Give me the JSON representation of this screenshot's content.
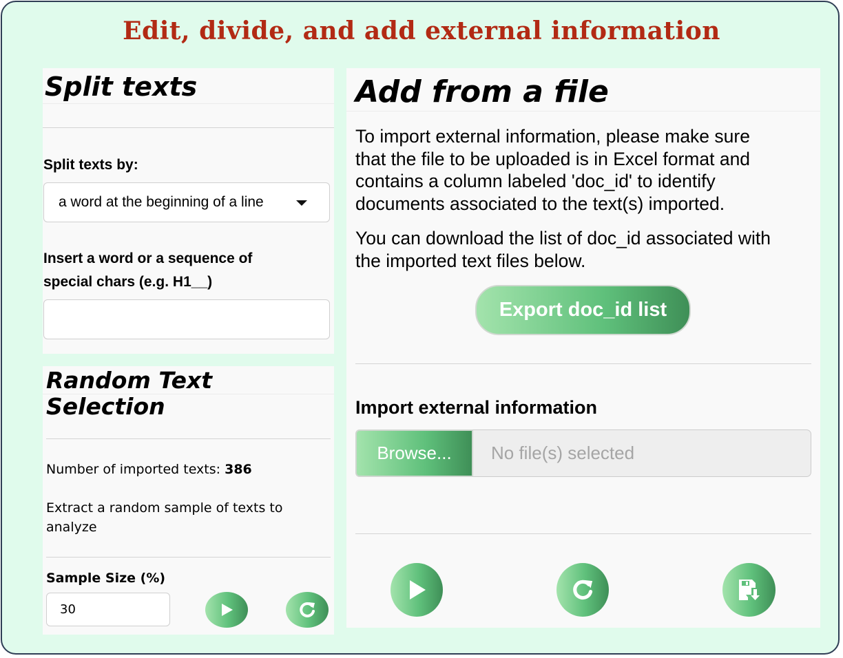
{
  "title": "Edit, divide, and add external information",
  "split_panel": {
    "heading": "Split texts",
    "split_by_label": "Split texts by:",
    "split_by_value": "a word at the beginning of a line",
    "insert_label_line1": "Insert a word or a sequence of",
    "insert_label_line2": "special chars (e.g. H1__)",
    "insert_value": ""
  },
  "random_panel": {
    "heading_line1": "Random Text",
    "heading_line2": "Selection",
    "imported_label": "Number of imported texts: ",
    "imported_count": "386",
    "extract_line1": "Extract a random sample of texts to",
    "extract_line2": "analyze",
    "sample_label": "Sample Size (%)",
    "sample_value": "30",
    "icons": {
      "run": "play-icon",
      "reset": "refresh-icon"
    }
  },
  "file_panel": {
    "heading": "Add from a file",
    "para1": [
      "To import external information, please make sure",
      "that the file to be uploaded is in Excel format and",
      "contains a column labeled 'doc_id' to identify",
      "documents associated to the text(s) imported."
    ],
    "para2": [
      "You can download the list of doc_id associated with",
      "the imported text files below."
    ],
    "export_button": "Export doc_id list",
    "import_label": "Import external information",
    "browse_button": "Browse...",
    "file_placeholder": "No file(s) selected",
    "icons": {
      "run": "play-icon",
      "reset": "refresh-icon",
      "save": "save-download-icon"
    }
  },
  "colors": {
    "title": "#b22a14",
    "background": "#e0fbec",
    "panel": "#f9f9f9",
    "button_light": "#a3e3ac",
    "button_dark": "#3f8f57"
  }
}
